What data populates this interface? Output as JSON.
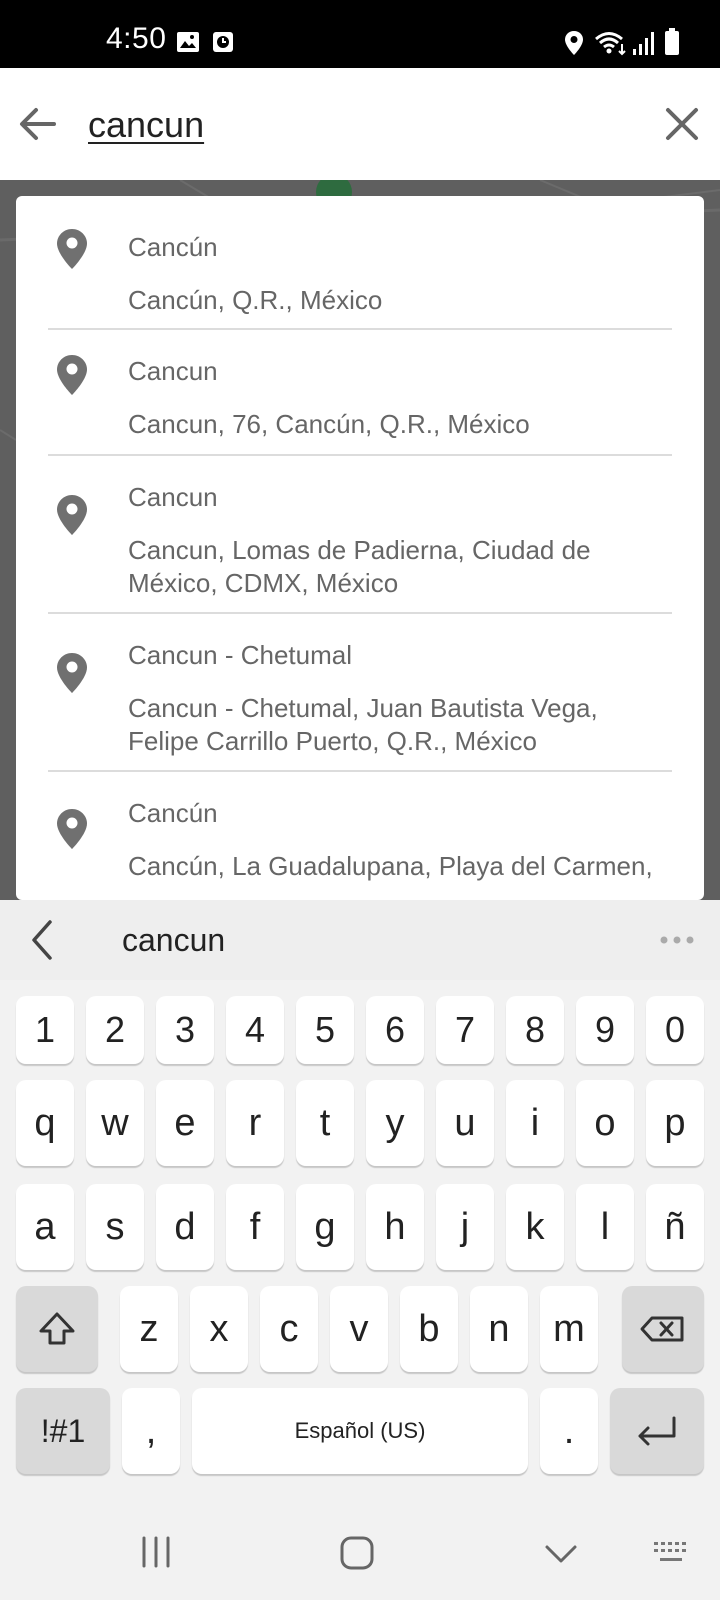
{
  "status_bar": {
    "time": "4:50",
    "left_icons": [
      "image-icon",
      "clock-icon"
    ],
    "right_icons": [
      "location-icon",
      "wifi-icon",
      "signal-icon",
      "battery-icon"
    ]
  },
  "search": {
    "query": "cancun",
    "back_icon": "arrow-left-icon",
    "clear_icon": "close-icon"
  },
  "suggestions": [
    {
      "title": "Cancún",
      "address": "Cancún, Q.R., México"
    },
    {
      "title": "Cancun",
      "address": "Cancun, 76, Cancún, Q.R., México"
    },
    {
      "title": "Cancun",
      "address": "Cancun, Lomas de Padierna, Ciudad de México, CDMX, México"
    },
    {
      "title": "Cancun - Chetumal",
      "address": "Cancun - Chetumal, Juan Bautista Vega, Felipe Carrillo Puerto, Q.R., México"
    },
    {
      "title": "Cancún",
      "address": "Cancún, La Guadalupana, Playa del Carmen,"
    }
  ],
  "keyboard": {
    "suggestion_word": "cancun",
    "digits": [
      "1",
      "2",
      "3",
      "4",
      "5",
      "6",
      "7",
      "8",
      "9",
      "0"
    ],
    "row1": [
      "q",
      "w",
      "e",
      "r",
      "t",
      "y",
      "u",
      "i",
      "o",
      "p"
    ],
    "row2": [
      "a",
      "s",
      "d",
      "f",
      "g",
      "h",
      "j",
      "k",
      "l",
      "ñ"
    ],
    "row3": [
      "z",
      "x",
      "c",
      "v",
      "b",
      "n",
      "m"
    ],
    "symbols_label": "!#1",
    "comma_label": ",",
    "space_label": "Español (US)",
    "period_label": "."
  },
  "colors": {
    "status_bar": "#000000",
    "map": "#5f5f5f",
    "keyboard_bg": "#f2f2f2",
    "key": "#ffffff",
    "key_dark": "#d9d9d9",
    "text_secondary": "#666666"
  }
}
